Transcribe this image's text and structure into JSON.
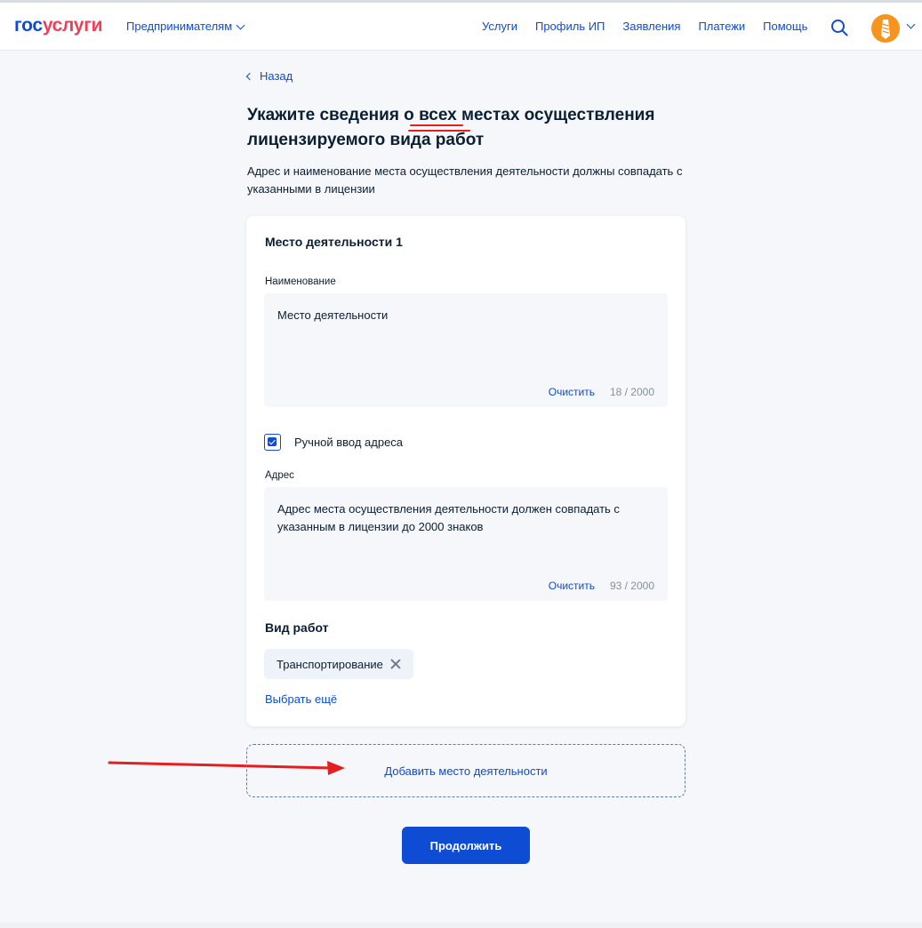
{
  "header": {
    "logo_part1": "гос",
    "logo_part2": "услуги",
    "audience": "Предпринимателям",
    "nav": [
      "Услуги",
      "Профиль ИП",
      "Заявления",
      "Платежи",
      "Помощь"
    ]
  },
  "back_label": "Назад",
  "page": {
    "title": "Укажите сведения о всех местах осуществления лицензируемого вида работ",
    "subtitle": "Адрес и наименование места осуществления деятельности должны совпадать с указанными в лицензии"
  },
  "card": {
    "title": "Место деятельности 1",
    "name_field": {
      "label": "Наименование",
      "value": "Место деятельности",
      "clear_label": "Очистить",
      "counter": "18 / 2000"
    },
    "manual_address": {
      "label": "Ручной ввод адреса",
      "checked": true
    },
    "address_field": {
      "label": "Адрес",
      "value": "Адрес места осуществления деятельности должен совпадать с указанным в лицензии до 2000 знаков",
      "clear_label": "Очистить",
      "counter": "93 / 2000"
    },
    "work_type": {
      "title": "Вид работ",
      "chips": [
        "Транспортирование"
      ],
      "select_more": "Выбрать ещё"
    }
  },
  "add_place_label": "Добавить место деятельности",
  "continue_label": "Продолжить",
  "colors": {
    "primary": "#0d4cd3",
    "logo_red": "#ee3f58",
    "annotation_red": "#e31f1f",
    "avatar": "#f7941d"
  },
  "icons": [
    "search-icon",
    "chevron-down-icon",
    "chevron-left-icon",
    "checkmark-icon",
    "close-icon",
    "avatar-icon"
  ]
}
